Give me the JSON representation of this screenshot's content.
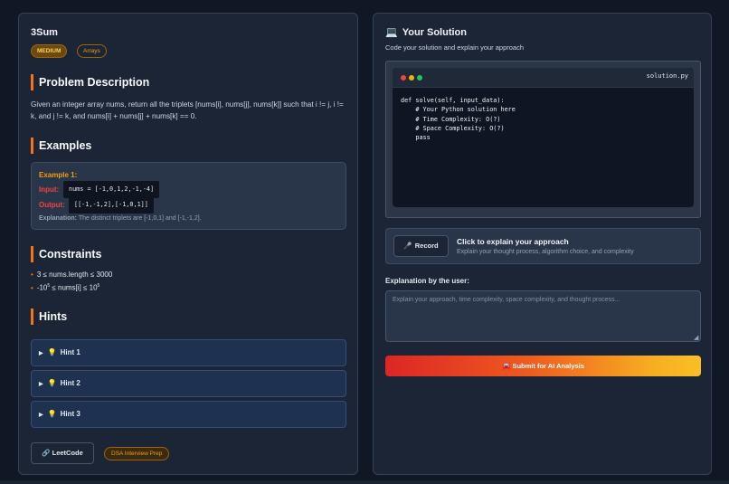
{
  "problem": {
    "title": "3Sum",
    "difficulty": "MEDIUM",
    "topic": "Arrays",
    "description_heading": "Problem Description",
    "description": "Given an integer array nums, return all the triplets [nums[i], nums[j], nums[k]] such that i != j, i != k, and j != k, and nums[i] + nums[j] + nums[k] == 0.",
    "examples_heading": "Examples",
    "example": {
      "title": "Example 1:",
      "input_label": "Input:",
      "input": "nums = [-1,0,1,2,-1,-4]",
      "output_label": "Output:",
      "output": "[[-1,-1,2],[-1,0,1]]",
      "explanation_label": "Explanation:",
      "explanation": "The distinct triplets are [-1,0,1] and [-1,-1,2]."
    },
    "constraints_heading": "Constraints",
    "constraints": [
      {
        "text": "3 ≤ nums.length ≤ 3000"
      },
      {
        "pre": "-10",
        "sup1": "5",
        "mid": " ≤ nums[i] ≤ 10",
        "sup2": "5"
      }
    ],
    "hints_heading": "Hints",
    "hints": [
      "Hint 1",
      "Hint 2",
      "Hint 3"
    ],
    "leetcode_button": "LeetCode",
    "source_tag": "DSA Interview Prep"
  },
  "solution": {
    "title": "Your Solution",
    "subtitle": "Code your solution and explain your approach",
    "filename": "solution.py",
    "code": "def solve(self, input_data):\n    # Your Python solution here\n    # Time Complexity: O(?)\n    # Space Complexity: O(?)\n    pass",
    "record_button": "Record",
    "record_title": "Click to explain your approach",
    "record_subtitle": "Explain your thought process, algorithm choice, and complexity",
    "explanation_label": "Explanation by the user:",
    "explanation_placeholder": "Explain your approach, time complexity, space complexity, and thought process...",
    "submit_button": "Submit for AI Analysis"
  },
  "icons": {
    "computer": "laptop-icon",
    "mic": "mic-icon",
    "link": "link-icon",
    "bulb": "lightbulb-icon",
    "car": "car-icon"
  },
  "colors": {
    "accent": "#f97316",
    "difficulty": "#f59e0b",
    "input_label": "#ef4444",
    "submit_gradient_start": "#dc2626",
    "submit_gradient_end": "#fbbf24"
  }
}
